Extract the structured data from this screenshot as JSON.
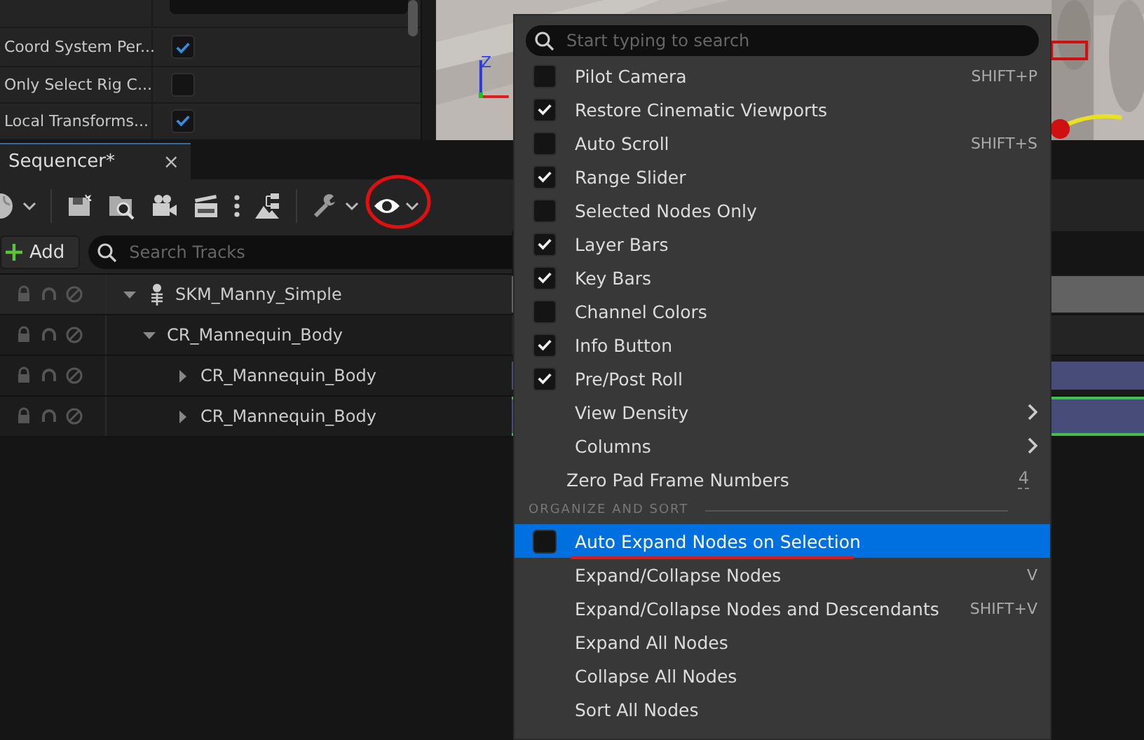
{
  "details": {
    "rows": [
      {
        "label": "Coord System Per...",
        "checked": true
      },
      {
        "label": "Only Select Rig C...",
        "checked": false
      },
      {
        "label": "Local Transforms...",
        "checked": true
      }
    ]
  },
  "viewport": {
    "axis_label": "Z"
  },
  "sequencer": {
    "tab": {
      "title": "Sequencer*",
      "close": "×"
    },
    "add_button": "Add",
    "search": {
      "placeholder": "Search Tracks"
    },
    "tracks": [
      {
        "name": "SKM_Manny_Simple",
        "kind": "skeleton",
        "expanded": true,
        "children": [
          {
            "name": "CR_Mannequin_Body",
            "expanded": true,
            "children": [
              {
                "name": "CR_Mannequin_Body",
                "expanded": false
              },
              {
                "name": "CR_Mannequin_Body",
                "expanded": false
              }
            ]
          }
        ]
      }
    ]
  },
  "menu": {
    "search": {
      "placeholder": "Start typing to search"
    },
    "items": [
      {
        "kind": "toggle",
        "label": "Pilot Camera",
        "checked": false,
        "shortcut": "SHIFT+P",
        "selected": false
      },
      {
        "kind": "toggle",
        "label": "Restore Cinematic Viewports",
        "checked": true,
        "selected": false
      },
      {
        "kind": "toggle",
        "label": "Auto Scroll",
        "checked": false,
        "shortcut": "SHIFT+S",
        "selected": false
      },
      {
        "kind": "toggle",
        "label": "Range Slider",
        "checked": true,
        "selected": false
      },
      {
        "kind": "toggle",
        "label": "Selected Nodes Only",
        "checked": false,
        "selected": false
      },
      {
        "kind": "toggle",
        "label": "Layer Bars",
        "checked": true,
        "selected": false
      },
      {
        "kind": "toggle",
        "label": "Key Bars",
        "checked": true,
        "selected": false
      },
      {
        "kind": "toggle",
        "label": "Channel Colors",
        "checked": false,
        "selected": false
      },
      {
        "kind": "toggle",
        "label": "Info Button",
        "checked": true,
        "selected": false
      },
      {
        "kind": "toggle",
        "label": "Pre/Post Roll",
        "checked": true,
        "selected": false
      },
      {
        "kind": "submenu",
        "label": "View Density",
        "selected": false
      },
      {
        "kind": "submenu",
        "label": "Columns",
        "selected": false
      },
      {
        "kind": "value",
        "label": "Zero Pad Frame Numbers",
        "value": "4",
        "selected": false
      },
      {
        "kind": "header",
        "label": "ORGANIZE AND SORT"
      },
      {
        "kind": "toggle",
        "label": "Auto Expand Nodes on Selection",
        "checked": false,
        "selected": true
      },
      {
        "kind": "action",
        "label": "Expand/Collapse Nodes",
        "shortcut": "V",
        "selected": false
      },
      {
        "kind": "action",
        "label": "Expand/Collapse Nodes and Descendants",
        "shortcut": "SHIFT+V",
        "selected": false
      },
      {
        "kind": "action",
        "label": "Expand All Nodes",
        "selected": false
      },
      {
        "kind": "action",
        "label": "Collapse All Nodes",
        "selected": false
      },
      {
        "kind": "action",
        "label": "Sort All Nodes",
        "selected": false
      }
    ]
  }
}
